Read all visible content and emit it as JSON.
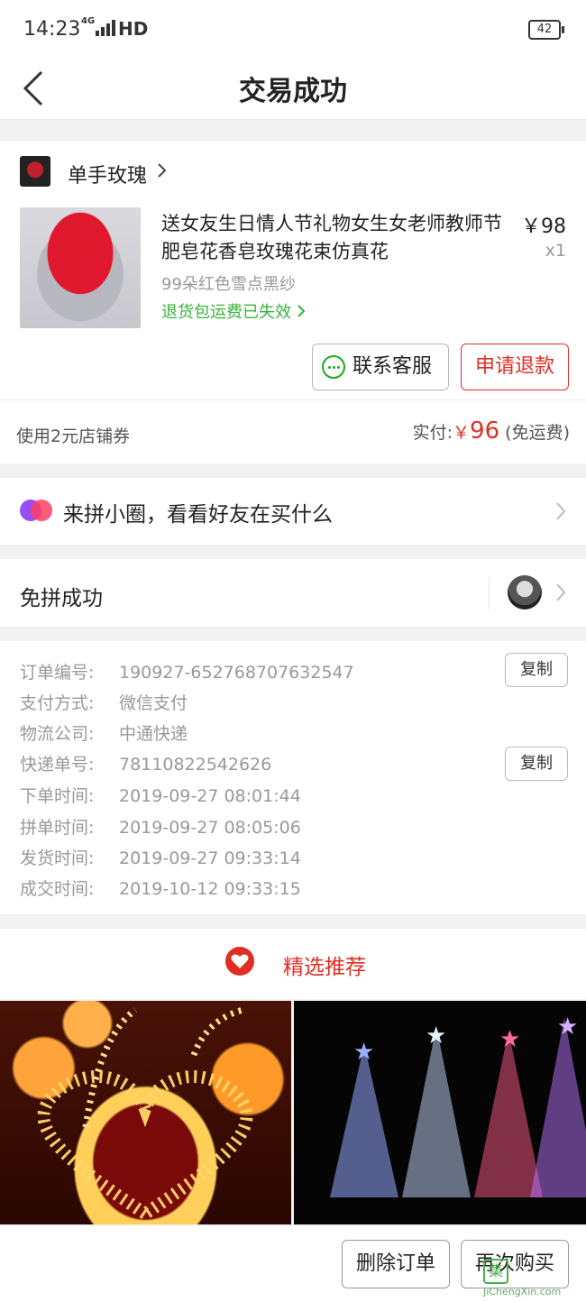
{
  "status_bar": {
    "time": "14:23",
    "network": "4G",
    "hd": "HD",
    "battery": "42"
  },
  "nav": {
    "title": "交易成功"
  },
  "order": {
    "shop_name": "单手玫瑰",
    "product_title": "送女友生日情人节礼物女生女老师教师节肥皂花香皂玫瑰花束仿真花",
    "price": "￥98",
    "quantity": "x1",
    "spec": "99朵红色雪点黑纱",
    "return_note": "退货包运费已失效",
    "btn_service": "联系客服",
    "btn_refund": "申请退款",
    "coupon": "使用2元店铺券",
    "paid_label": "实付:",
    "paid_currency": "￥",
    "paid_amount": "96",
    "paid_note": "(免运费)"
  },
  "circle": {
    "text": "来拼小圈，看看好友在买什么"
  },
  "free_group": {
    "text": "免拼成功"
  },
  "info": {
    "rows": [
      {
        "k": "订单编号:",
        "v": "190927-652768707632547"
      },
      {
        "k": "支付方式:",
        "v": "微信支付"
      },
      {
        "k": "物流公司:",
        "v": "中通快递"
      },
      {
        "k": "快递单号:",
        "v": "78110822542626"
      },
      {
        "k": "下单时间:",
        "v": "2019-09-27 08:01:44"
      },
      {
        "k": "拼单时间:",
        "v": "2019-09-27 08:05:06"
      },
      {
        "k": "发货时间:",
        "v": "2019-09-27 09:33:14"
      },
      {
        "k": "成交时间:",
        "v": "2019-10-12 09:33:15"
      }
    ],
    "copy_label": "复制"
  },
  "recommend": {
    "title": "精选推荐"
  },
  "bottom": {
    "delete": "删除订单",
    "rebuy": "再次购买"
  },
  "watermark": {
    "url": "JiChengXin.com"
  },
  "colors": {
    "accent": "#e02e24",
    "green": "#3ab33a",
    "bg": "#f2f2f2"
  }
}
